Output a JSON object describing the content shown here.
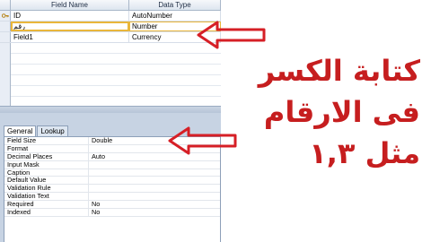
{
  "field_grid": {
    "headers": {
      "name": "Field Name",
      "type": "Data Type"
    },
    "rows": [
      {
        "name": "ID",
        "type": "AutoNumber",
        "primary_key": true
      },
      {
        "name": "رقم",
        "type": "Number",
        "active": true
      },
      {
        "name": "Field1",
        "type": "Currency"
      }
    ]
  },
  "properties": {
    "tabs": [
      "General",
      "Lookup"
    ],
    "active_tab": "General",
    "rows": [
      {
        "label": "Field Size",
        "value": "Double"
      },
      {
        "label": "Format",
        "value": ""
      },
      {
        "label": "Decimal Places",
        "value": "Auto"
      },
      {
        "label": "Input Mask",
        "value": ""
      },
      {
        "label": "Caption",
        "value": ""
      },
      {
        "label": "Default Value",
        "value": ""
      },
      {
        "label": "Validation Rule",
        "value": ""
      },
      {
        "label": "Validation Text",
        "value": ""
      },
      {
        "label": "Required",
        "value": "No"
      },
      {
        "label": "Indexed",
        "value": "No"
      }
    ]
  },
  "caption": {
    "line1": "كتابة الكسر",
    "line2": "فى الارقام",
    "line3": "مثل ١,٣"
  },
  "colors": {
    "arrow": "#d61f26",
    "caption": "#c61e1f",
    "highlight": "#e9b63b"
  },
  "icons": {
    "primary_key": "key-icon",
    "arrow": "arrow-left-icon"
  }
}
